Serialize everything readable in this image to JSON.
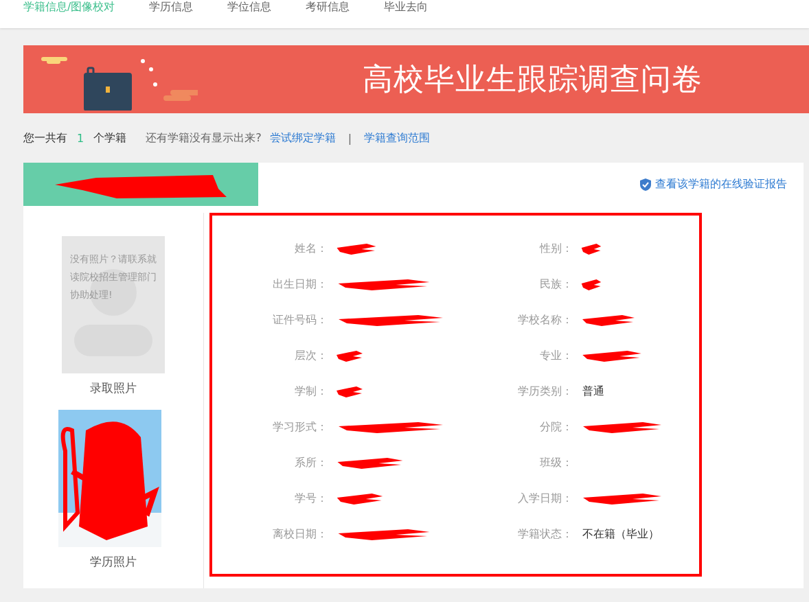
{
  "nav": {
    "tabs": [
      {
        "label": "学籍信息/图像校对",
        "selected": true
      },
      {
        "label": "学历信息",
        "selected": false
      },
      {
        "label": "学位信息",
        "selected": false
      },
      {
        "label": "考研信息",
        "selected": false
      },
      {
        "label": "毕业去向",
        "selected": false
      }
    ]
  },
  "banner": {
    "title": "高校毕业生跟踪调查问卷"
  },
  "summary": {
    "prefix": "您一共有",
    "count": "1",
    "suffix": "个学籍",
    "question": "还有学籍没有显示出来?",
    "links": [
      "尝试绑定学籍",
      "学籍查询范围"
    ],
    "separator": "|"
  },
  "record": {
    "header_redacted": true,
    "report_link": "查看该学籍的在线验证报告",
    "photos": [
      {
        "kind": "placeholder",
        "note": "没有照片？请联系就读院校招生管理部门协助处理!",
        "caption": "录取照片"
      },
      {
        "kind": "picture",
        "caption": "学历照片"
      }
    ],
    "details_highlighted": true,
    "fields": [
      {
        "label": "姓名：",
        "redacted": true
      },
      {
        "label": "性别：",
        "redacted": true
      },
      {
        "label": "出生日期：",
        "redacted": true
      },
      {
        "label": "民族：",
        "redacted": true
      },
      {
        "label": "证件号码：",
        "redacted": true
      },
      {
        "label": "学校名称：",
        "redacted": true
      },
      {
        "label": "层次：",
        "redacted": true
      },
      {
        "label": "专业：",
        "redacted": true
      },
      {
        "label": "学制：",
        "redacted": true
      },
      {
        "label": "学历类别：",
        "redacted": false,
        "value": "普通"
      },
      {
        "label": "学习形式：",
        "redacted": true
      },
      {
        "label": "分院：",
        "redacted": true
      },
      {
        "label": "系所：",
        "redacted": true
      },
      {
        "label": "班级：",
        "redacted": false
      },
      {
        "label": "学号：",
        "redacted": true
      },
      {
        "label": "入学日期：",
        "redacted": true
      },
      {
        "label": "离校日期：",
        "redacted": true
      },
      {
        "label": "学籍状态：",
        "redacted": false,
        "value": "不在籍（毕业）"
      }
    ]
  }
}
